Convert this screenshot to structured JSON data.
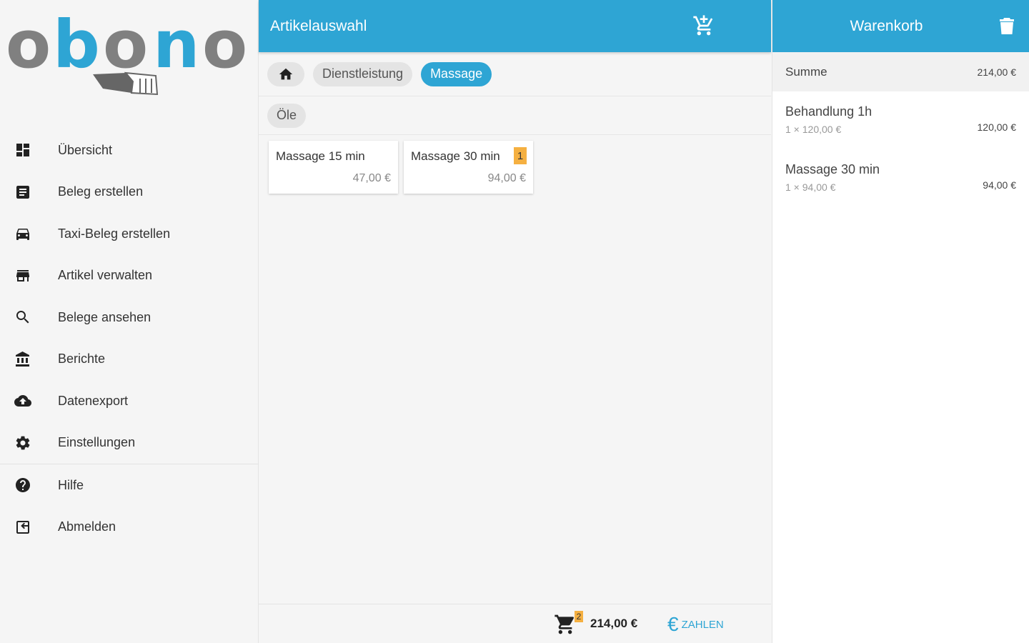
{
  "logo": {
    "text": "obono",
    "colors": [
      "#808080",
      "#2ea5d4",
      "#808080",
      "#2ea5d4",
      "#808080"
    ]
  },
  "sidebar": {
    "items": [
      {
        "label": "Übersicht",
        "icon": "dashboard-icon"
      },
      {
        "label": "Beleg erstellen",
        "icon": "receipt-icon"
      },
      {
        "label": "Taxi-Beleg erstellen",
        "icon": "taxi-icon"
      },
      {
        "label": "Artikel verwalten",
        "icon": "store-icon"
      },
      {
        "label": "Belege ansehen",
        "icon": "search-icon"
      },
      {
        "label": "Berichte",
        "icon": "bank-icon"
      },
      {
        "label": "Datenexport",
        "icon": "cloud-upload-icon"
      },
      {
        "label": "Einstellungen",
        "icon": "gear-icon"
      },
      {
        "label": "Hilfe",
        "icon": "help-icon"
      },
      {
        "label": "Abmelden",
        "icon": "logout-icon"
      }
    ]
  },
  "main": {
    "title": "Artikelauswahl",
    "breadcrumbs": [
      "Dienstleistung",
      "Massage"
    ],
    "subcategories": [
      "Öle"
    ],
    "products": [
      {
        "name": "Massage 15 min",
        "price": "47,00 €",
        "qty": ""
      },
      {
        "name": "Massage 30 min",
        "price": "94,00 €",
        "qty": "1"
      }
    ],
    "footer": {
      "cart_count": "2",
      "total": "214,00 €",
      "pay_label": "ZAHLEN",
      "euro_symbol": "€"
    }
  },
  "cart": {
    "title": "Warenkorb",
    "sum_label": "Summe",
    "sum_value": "214,00 €",
    "items": [
      {
        "name": "Behandlung 1h",
        "detail": "1 × 120,00 €",
        "price": "120,00 €"
      },
      {
        "name": "Massage 30 min",
        "detail": "1 × 94,00 €",
        "price": "94,00 €"
      }
    ]
  },
  "colors": {
    "accent": "#2ea5d4",
    "badge": "#f5b041"
  }
}
